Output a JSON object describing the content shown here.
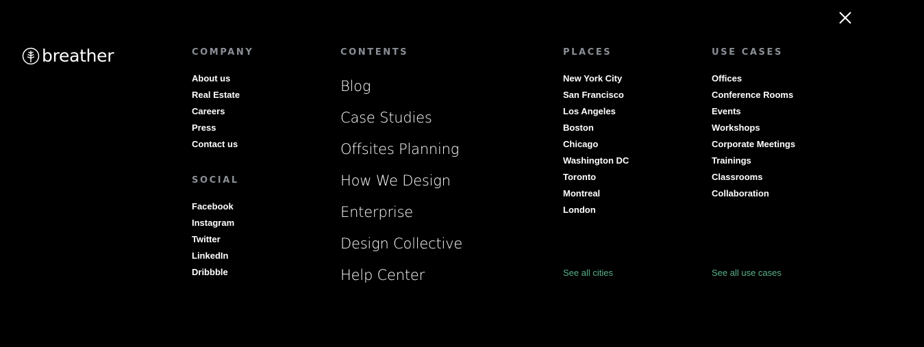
{
  "brand": {
    "name": "breather",
    "logo_icon": "tree-leaf-icon"
  },
  "close_icon": "close-icon",
  "company": {
    "heading": "COMPANY",
    "items": [
      "About us",
      "Real Estate",
      "Careers",
      "Press",
      "Contact us"
    ]
  },
  "social": {
    "heading": "SOCIAL",
    "items": [
      "Facebook",
      "Instagram",
      "Twitter",
      "LinkedIn",
      "Dribbble"
    ]
  },
  "contents": {
    "heading": "CONTENTS",
    "items": [
      "Blog",
      "Case Studies",
      "Offsites Planning",
      "How We Design",
      "Enterprise",
      "Design Collective",
      "Help Center"
    ]
  },
  "places": {
    "heading": "PLACES",
    "items": [
      "New York City",
      "San Francisco",
      "Los Angeles",
      "Boston",
      "Chicago",
      "Washington DC",
      "Toronto",
      "Montreal",
      "London"
    ],
    "see_all": "See all cities"
  },
  "use_cases": {
    "heading": "USE CASES",
    "items": [
      "Offices",
      "Conference Rooms",
      "Events",
      "Workshops",
      "Corporate Meetings",
      "Trainings",
      "Classrooms",
      "Collaboration"
    ],
    "see_all": "See all use cases"
  },
  "colors": {
    "background": "#000000",
    "text": "#ffffff",
    "heading": "#8a8f96",
    "accent_link": "#5ab38a"
  }
}
